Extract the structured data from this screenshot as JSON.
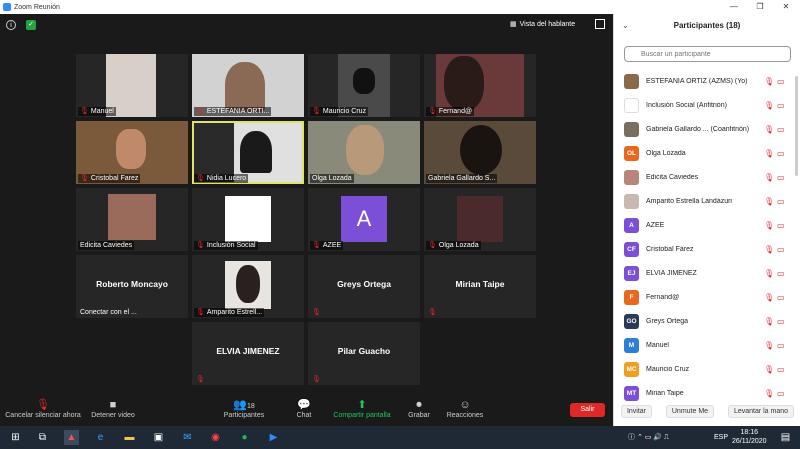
{
  "window": {
    "title": "Zoom Reunión"
  },
  "topbar": {
    "speaker_view_label": "Vista del hablante"
  },
  "tiles": [
    {
      "name": "Manuel"
    },
    {
      "name": "ESTEFANIA ORTI..."
    },
    {
      "name": "Mauricio Cruz"
    },
    {
      "name": "Fernand@"
    },
    {
      "name": "Cristobal Farez"
    },
    {
      "name": "Nidia Lucero"
    },
    {
      "name": "Olga Lozada"
    },
    {
      "name": "Gabriela Gallardo S..."
    },
    {
      "name": "Edicita Caviedes"
    },
    {
      "name": "Inclusión Social"
    },
    {
      "name": "AZEE",
      "initial": "A"
    },
    {
      "name": "Olga Lozada"
    },
    {
      "name": "Conectar con el ...",
      "big": "Roberto Moncayo"
    },
    {
      "name": "Amparito Estrell..."
    },
    {
      "big": "Greys Ortega"
    },
    {
      "big": "Mirian Taipe"
    },
    {
      "big": "ELVIA JIMENEZ"
    },
    {
      "big": "Pilar Guacho"
    }
  ],
  "toolbar": {
    "unmute": "Cancelar silenciar ahora",
    "stop_video": "Detener video",
    "participants": "Participantes",
    "participants_count": "18",
    "chat": "Chat",
    "share": "Compartir pantalla",
    "record": "Grabar",
    "reactions": "Reacciones",
    "leave": "Salir"
  },
  "panel": {
    "title": "Participantes (18)",
    "search_placeholder": "Buscar un participante",
    "participants": [
      {
        "name": "ESTEFANIA ORTIZ (AZMS) (Yo)",
        "initials": "",
        "color": "#8a6a4a"
      },
      {
        "name": "Inclusión Social (Anfitrión)",
        "initials": "",
        "color": "#ffffff"
      },
      {
        "name": "Gabriela Gallardo ... (Coanfitrión)",
        "initials": "",
        "color": "#7a6e5e"
      },
      {
        "name": "Olga Lozada",
        "initials": "OL",
        "color": "#e8681e"
      },
      {
        "name": "Edicita Caviedes",
        "initials": "",
        "color": "#b7857a"
      },
      {
        "name": "Amparito Estrella Landázuri",
        "initials": "",
        "color": "#c9b8b0"
      },
      {
        "name": "AZEE",
        "initials": "A",
        "color": "#7d4fd6"
      },
      {
        "name": "Cristobal Fárez",
        "initials": "CF",
        "color": "#7d4fd6"
      },
      {
        "name": "ELVIA JIMENEZ",
        "initials": "EJ",
        "color": "#7d4fd6"
      },
      {
        "name": "Fernand@",
        "initials": "F",
        "color": "#e8681e"
      },
      {
        "name": "Greys Ortega",
        "initials": "GO",
        "color": "#2b3a55"
      },
      {
        "name": "Manuel",
        "initials": "M",
        "color": "#2d7fd8"
      },
      {
        "name": "Mauricio Cruz",
        "initials": "MC",
        "color": "#f0a020"
      },
      {
        "name": "Mirian Taipe",
        "initials": "MT",
        "color": "#7d4fd6"
      }
    ],
    "invite": "Invitar",
    "unmute_me": "Unmute Me",
    "raise_hand": "Levantar la mano"
  },
  "taskbar": {
    "language": "ESP",
    "time": "18:16",
    "date": "26/11/2020"
  }
}
